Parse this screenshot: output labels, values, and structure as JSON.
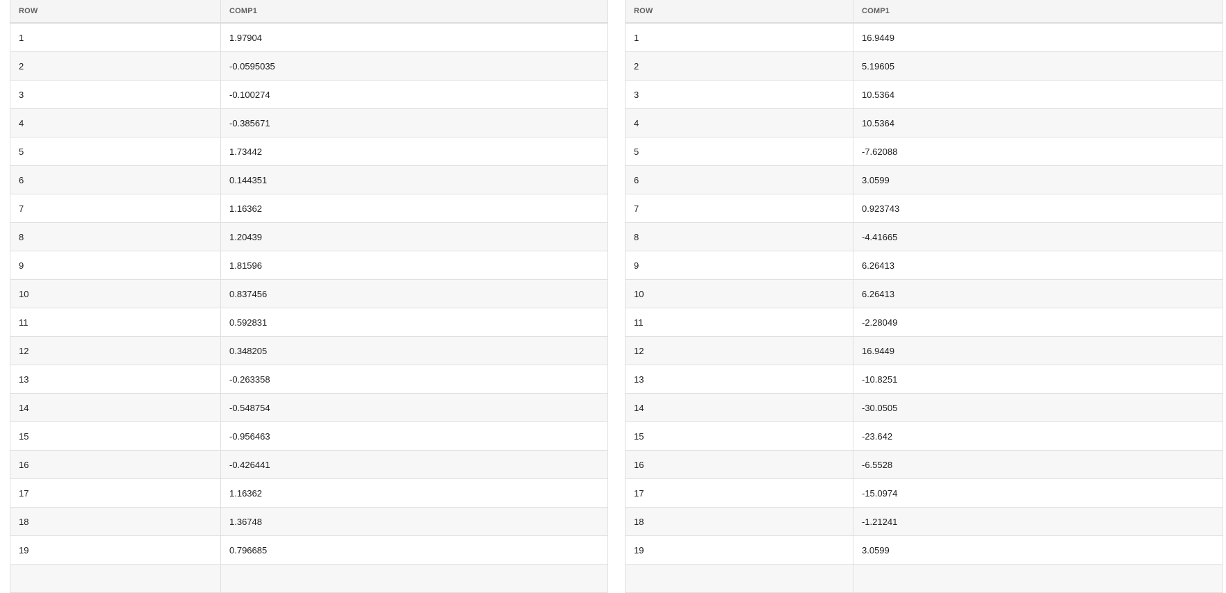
{
  "tables": [
    {
      "headers": [
        "ROW",
        "COMP1"
      ],
      "rows": [
        [
          "1",
          "1.97904"
        ],
        [
          "2",
          "-0.0595035"
        ],
        [
          "3",
          "-0.100274"
        ],
        [
          "4",
          "-0.385671"
        ],
        [
          "5",
          "1.73442"
        ],
        [
          "6",
          "0.144351"
        ],
        [
          "7",
          "1.16362"
        ],
        [
          "8",
          "1.20439"
        ],
        [
          "9",
          "1.81596"
        ],
        [
          "10",
          "0.837456"
        ],
        [
          "11",
          "0.592831"
        ],
        [
          "12",
          "0.348205"
        ],
        [
          "13",
          "-0.263358"
        ],
        [
          "14",
          "-0.548754"
        ],
        [
          "15",
          "-0.956463"
        ],
        [
          "16",
          "-0.426441"
        ],
        [
          "17",
          "1.16362"
        ],
        [
          "18",
          "1.36748"
        ],
        [
          "19",
          "0.796685"
        ],
        [
          "",
          ""
        ]
      ]
    },
    {
      "headers": [
        "ROW",
        "COMP1"
      ],
      "rows": [
        [
          "1",
          "16.9449"
        ],
        [
          "2",
          "5.19605"
        ],
        [
          "3",
          "10.5364"
        ],
        [
          "4",
          "10.5364"
        ],
        [
          "5",
          "-7.62088"
        ],
        [
          "6",
          "3.0599"
        ],
        [
          "7",
          "0.923743"
        ],
        [
          "8",
          "-4.41665"
        ],
        [
          "9",
          "6.26413"
        ],
        [
          "10",
          "6.26413"
        ],
        [
          "11",
          "-2.28049"
        ],
        [
          "12",
          "16.9449"
        ],
        [
          "13",
          "-10.8251"
        ],
        [
          "14",
          "-30.0505"
        ],
        [
          "15",
          "-23.642"
        ],
        [
          "16",
          "-6.5528"
        ],
        [
          "17",
          "-15.0974"
        ],
        [
          "18",
          "-1.21241"
        ],
        [
          "19",
          "3.0599"
        ],
        [
          "",
          ""
        ]
      ]
    }
  ]
}
